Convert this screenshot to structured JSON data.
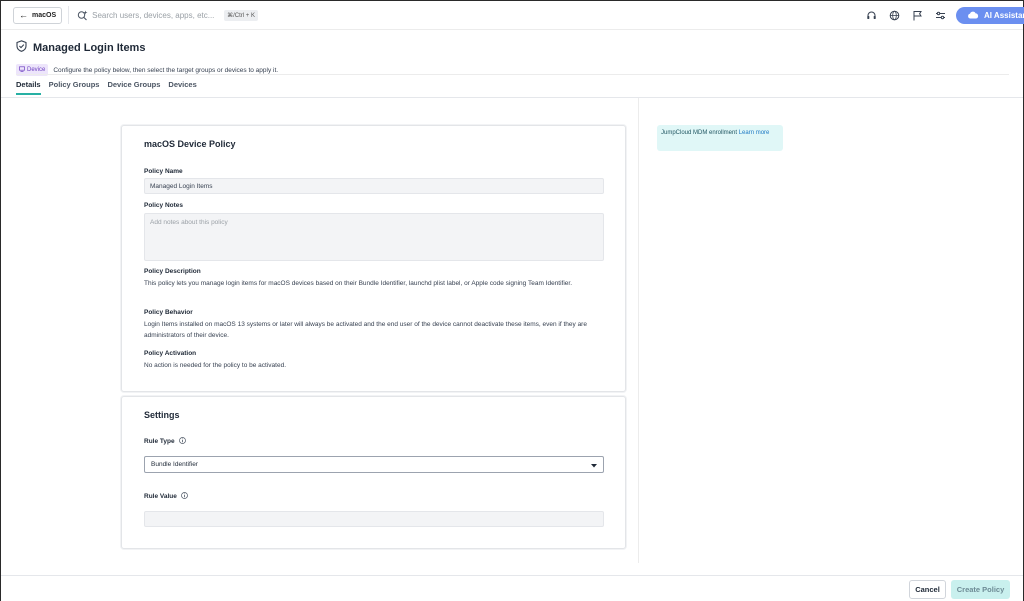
{
  "topbar": {
    "back_label": "macOS",
    "search_placeholder": "Search users, devices, apps, etc...",
    "shortcut": "⌘/Ctrl + K",
    "icons": [
      "headset-icon",
      "globe-icon",
      "flag-icon",
      "settings-sliders-icon"
    ],
    "ai_label": "AI Assistant"
  },
  "header": {
    "title": "Managed Login Items",
    "badge": "Device",
    "subtitle": "Configure the policy below, then select the target groups or devices to apply it."
  },
  "tabs": [
    "Details",
    "Policy Groups",
    "Device Groups",
    "Devices"
  ],
  "policy_card": {
    "title": "macOS Device Policy",
    "name_label": "Policy Name",
    "name_value": "Managed Login Items",
    "notes_label": "Policy Notes",
    "notes_placeholder": "Add notes about this policy",
    "description_label": "Policy Description",
    "description_text": "This policy lets you manage login items for macOS devices based on their Bundle Identifier, launchd plist label, or Apple code signing Team Identifier.",
    "behavior_label": "Policy Behavior",
    "behavior_text": "Login Items installed on macOS 13 systems or later will always be activated and the end user of the device cannot deactivate these items, even if they are administrators of their device.",
    "activation_label": "Policy Activation",
    "activation_text": "No action is needed for the policy to be activated."
  },
  "settings_card": {
    "title": "Settings",
    "rule_type_label": "Rule Type",
    "rule_type_value": "Bundle Identifier",
    "rule_value_label": "Rule Value",
    "rule_value_value": ""
  },
  "side_notice": {
    "text": "JumpCloud MDM enrollment",
    "link": "Learn more"
  },
  "footer": {
    "cancel_label": "Cancel",
    "create_label": "Create Policy"
  },
  "colors": {
    "accent": "#27b0a4",
    "ai_button": "#6b8ff0",
    "badge_bg": "#ede5fb",
    "notice_bg": "#e0f7f7",
    "create_bg": "#c9f0ee"
  }
}
